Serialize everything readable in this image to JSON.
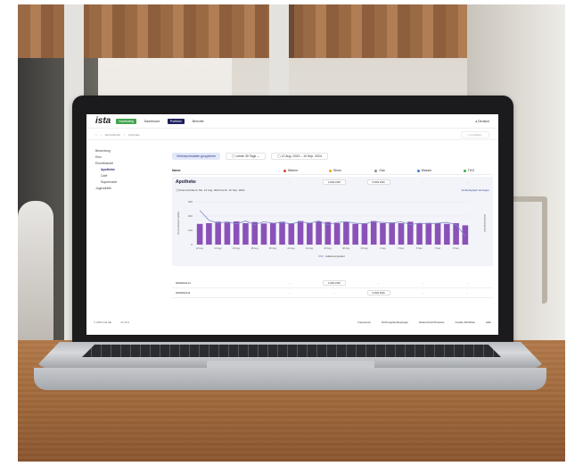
{
  "app": {
    "logo": "ista",
    "logo_badge": "Nachhaltig",
    "nav": [
      "Dashboard",
      "Portfolio",
      "Berichte"
    ],
    "active_nav": "Portfolio",
    "language": "Deutsch"
  },
  "breadcrumb": [
    "Einzelhandel",
    "Apotheke"
  ],
  "search_placeholder": "Immobilie...",
  "sidebar": [
    {
      "label": "Bewertung",
      "level": 0
    },
    {
      "label": "Kino",
      "level": 0
    },
    {
      "label": "Einzelhandel",
      "level": 0
    },
    {
      "label": "Apotheke",
      "level": 1,
      "active": true
    },
    {
      "label": "Café",
      "level": 1
    },
    {
      "label": "Supermarkt",
      "level": 1
    },
    {
      "label": "Jugendhilfe",
      "level": 0
    }
  ],
  "toolbar": {
    "group_button": "Verbrauchsdaten gruppieren",
    "period": "Letzte 30 Tage",
    "date_range": "12 Aug. 2024 – 10 Sep. 2024"
  },
  "table": {
    "name_header": "Name",
    "columns": [
      {
        "label": "Wärme",
        "color": "#e0462f"
      },
      {
        "label": "Strom",
        "color": "#f2a71e"
      },
      {
        "label": "Gas",
        "color": "#8a8f98"
      },
      {
        "label": "Wasser",
        "color": "#3a7bd5"
      },
      {
        "label": "THG",
        "color": "#47a84c"
      }
    ]
  },
  "section": {
    "title": "Apotheke",
    "cells": [
      "–",
      "4.600 kWh",
      "9.803 kWh",
      "–",
      "–"
    ],
    "chart_caption": "Stromverbrauch, Mo. 12 Aug. 2024 bis Di. 10 Sep. 2024",
    "chart_link": "Verlaufsgraph anzeigen"
  },
  "rows": [
    {
      "id": "0000002213",
      "cells": [
        "–",
        "4.600 kWh",
        "–",
        "–",
        "–"
      ]
    },
    {
      "id": "0000002211",
      "cells": [
        "–",
        "–",
        "9.803 kWh",
        "–",
        "–"
      ]
    }
  ],
  "footer": {
    "copyright": "© 2024 ista SE",
    "version": "v4.12.0",
    "links": [
      "Impressum",
      "Nutzungsbedingungen",
      "Datenschutzhinweise",
      "Cookie-Richtlinie",
      "Hilfe"
    ]
  },
  "chart_data": {
    "type": "bar",
    "categories": [
      "12 Aug.",
      "13 Aug.",
      "14 Aug.",
      "15 Aug.",
      "16 Aug.",
      "17 Aug.",
      "18 Aug.",
      "19 Aug.",
      "20 Aug.",
      "21 Aug.",
      "22 Aug.",
      "23 Aug.",
      "24 Aug.",
      "25 Aug.",
      "26 Aug.",
      "27 Aug.",
      "28 Aug.",
      "29 Aug.",
      "30 Aug.",
      "31 Aug.",
      "1 Sep.",
      "2 Sep.",
      "3 Sep.",
      "4 Sep.",
      "5 Sep.",
      "6 Sep.",
      "7 Sep.",
      "8 Sep.",
      "9 Sep.",
      "10 Sep."
    ],
    "tick_labels": [
      "12 Aug.",
      "14 Aug.",
      "16 Aug.",
      "18 Aug.",
      "20 Aug.",
      "22 Aug.",
      "24 Aug.",
      "26 Aug.",
      "28 Aug.",
      "30 Aug.",
      "1 Sep.",
      "3 Sep.",
      "5 Sep.",
      "7 Sep.",
      "9 Sep."
    ],
    "values": [
      145,
      150,
      160,
      155,
      162,
      150,
      158,
      148,
      152,
      160,
      150,
      165,
      150,
      162,
      158,
      150,
      160,
      145,
      150,
      165,
      150,
      155,
      150,
      160,
      148,
      152,
      150,
      145,
      150,
      135
    ],
    "line": [
      240,
      170,
      150,
      160,
      145,
      165,
      140,
      160,
      150,
      155,
      145,
      160,
      150,
      165,
      140,
      155,
      160,
      150,
      145,
      160,
      155,
      150,
      160,
      140,
      150,
      145,
      150,
      155,
      140,
      60
    ],
    "ylim": [
      0,
      300
    ],
    "yticks": [
      0,
      100,
      200,
      300
    ],
    "ylabel": "Stromverbrauch (kWh)",
    "y2label": "Außentemperatur",
    "legend": "Außentemperatur",
    "bar_color": "#8a52b8",
    "line_color": "#7d8bc8"
  }
}
